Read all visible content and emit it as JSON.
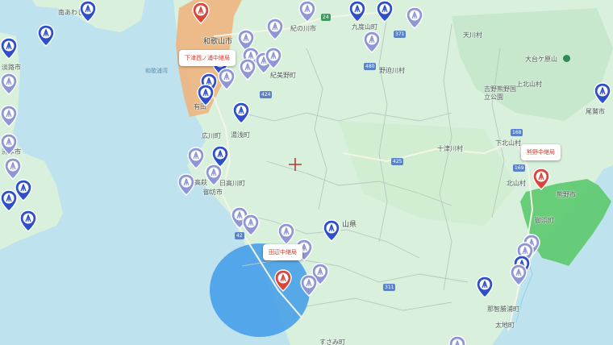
{
  "colors": {
    "land": "#d8f0dc",
    "sea": "#bfe3ee",
    "highlight_orange": "#f0b27a",
    "highlight_blue": "#3f9be8",
    "highlight_green": "#5cc96d",
    "marker_blue": "#2f4fc9",
    "marker_light": "#8f96d6",
    "marker_red": "#d9453a"
  },
  "places": {
    "minamiawaji": "南あわじ市",
    "wakayama_city": "和歌山市",
    "kinokawa": "紀の川市",
    "kudoyama": "九度山町",
    "tenkawa": "天川村",
    "kimino": "紀美野町",
    "nosegawa": "野迫川村",
    "odaigahara": "大台ケ原山",
    "yoshino_park": "吉野熊野国立公園",
    "kamikitayama": "上北山村",
    "owase": "尾鷲市",
    "arida": "有田",
    "hirokawa": "広川町",
    "yuasa": "湯浅町",
    "totsukawa": "十津川村",
    "shimokitayama": "下北山村",
    "kitayama": "北山村",
    "kumano": "熊野市",
    "mihama": "御浜町",
    "gobo": "御坊市",
    "takahagi": "高萩",
    "hidakagawa": "日高川町",
    "wakayama_pref": "山県",
    "nachikatsuura": "那智勝浦町",
    "taiji": "太地町",
    "susami": "すさみ町",
    "awaji": "淡路市",
    "sumoto": "洲本市"
  },
  "sea_labels": {
    "kitan": "和歌浦湾"
  },
  "roads": {
    "r24": "24",
    "r371": "371",
    "r480": "480",
    "r424": "424",
    "r42": "42",
    "r425": "425",
    "r168": "168",
    "r169": "169",
    "r311": "311"
  },
  "callouts": {
    "shimotsu": "下津西ノ浦中継局",
    "kumano": "熊野中継局",
    "tanabe": "田辺中継局"
  }
}
